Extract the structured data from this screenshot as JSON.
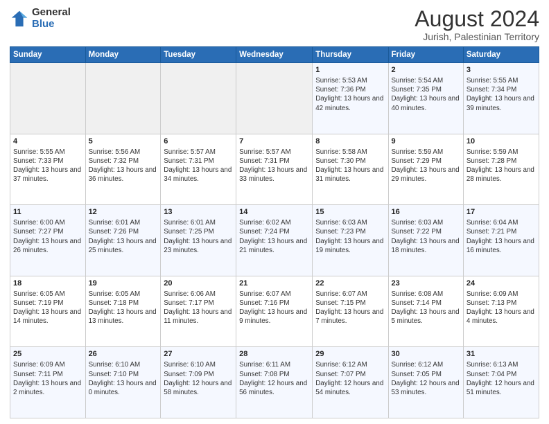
{
  "logo": {
    "general": "General",
    "blue": "Blue"
  },
  "header": {
    "title": "August 2024",
    "subtitle": "Jurish, Palestinian Territory"
  },
  "weekdays": [
    "Sunday",
    "Monday",
    "Tuesday",
    "Wednesday",
    "Thursday",
    "Friday",
    "Saturday"
  ],
  "weeks": [
    [
      {
        "day": "",
        "empty": true
      },
      {
        "day": "",
        "empty": true
      },
      {
        "day": "",
        "empty": true
      },
      {
        "day": "",
        "empty": true
      },
      {
        "day": "1",
        "sunrise": "5:53 AM",
        "sunset": "7:36 PM",
        "daylight": "13 hours and 42 minutes."
      },
      {
        "day": "2",
        "sunrise": "5:54 AM",
        "sunset": "7:35 PM",
        "daylight": "13 hours and 40 minutes."
      },
      {
        "day": "3",
        "sunrise": "5:55 AM",
        "sunset": "7:34 PM",
        "daylight": "13 hours and 39 minutes."
      }
    ],
    [
      {
        "day": "4",
        "sunrise": "5:55 AM",
        "sunset": "7:33 PM",
        "daylight": "13 hours and 37 minutes."
      },
      {
        "day": "5",
        "sunrise": "5:56 AM",
        "sunset": "7:32 PM",
        "daylight": "13 hours and 36 minutes."
      },
      {
        "day": "6",
        "sunrise": "5:57 AM",
        "sunset": "7:31 PM",
        "daylight": "13 hours and 34 minutes."
      },
      {
        "day": "7",
        "sunrise": "5:57 AM",
        "sunset": "7:31 PM",
        "daylight": "13 hours and 33 minutes."
      },
      {
        "day": "8",
        "sunrise": "5:58 AM",
        "sunset": "7:30 PM",
        "daylight": "13 hours and 31 minutes."
      },
      {
        "day": "9",
        "sunrise": "5:59 AM",
        "sunset": "7:29 PM",
        "daylight": "13 hours and 29 minutes."
      },
      {
        "day": "10",
        "sunrise": "5:59 AM",
        "sunset": "7:28 PM",
        "daylight": "13 hours and 28 minutes."
      }
    ],
    [
      {
        "day": "11",
        "sunrise": "6:00 AM",
        "sunset": "7:27 PM",
        "daylight": "13 hours and 26 minutes."
      },
      {
        "day": "12",
        "sunrise": "6:01 AM",
        "sunset": "7:26 PM",
        "daylight": "13 hours and 25 minutes."
      },
      {
        "day": "13",
        "sunrise": "6:01 AM",
        "sunset": "7:25 PM",
        "daylight": "13 hours and 23 minutes."
      },
      {
        "day": "14",
        "sunrise": "6:02 AM",
        "sunset": "7:24 PM",
        "daylight": "13 hours and 21 minutes."
      },
      {
        "day": "15",
        "sunrise": "6:03 AM",
        "sunset": "7:23 PM",
        "daylight": "13 hours and 19 minutes."
      },
      {
        "day": "16",
        "sunrise": "6:03 AM",
        "sunset": "7:22 PM",
        "daylight": "13 hours and 18 minutes."
      },
      {
        "day": "17",
        "sunrise": "6:04 AM",
        "sunset": "7:21 PM",
        "daylight": "13 hours and 16 minutes."
      }
    ],
    [
      {
        "day": "18",
        "sunrise": "6:05 AM",
        "sunset": "7:19 PM",
        "daylight": "13 hours and 14 minutes."
      },
      {
        "day": "19",
        "sunrise": "6:05 AM",
        "sunset": "7:18 PM",
        "daylight": "13 hours and 13 minutes."
      },
      {
        "day": "20",
        "sunrise": "6:06 AM",
        "sunset": "7:17 PM",
        "daylight": "13 hours and 11 minutes."
      },
      {
        "day": "21",
        "sunrise": "6:07 AM",
        "sunset": "7:16 PM",
        "daylight": "13 hours and 9 minutes."
      },
      {
        "day": "22",
        "sunrise": "6:07 AM",
        "sunset": "7:15 PM",
        "daylight": "13 hours and 7 minutes."
      },
      {
        "day": "23",
        "sunrise": "6:08 AM",
        "sunset": "7:14 PM",
        "daylight": "13 hours and 5 minutes."
      },
      {
        "day": "24",
        "sunrise": "6:09 AM",
        "sunset": "7:13 PM",
        "daylight": "13 hours and 4 minutes."
      }
    ],
    [
      {
        "day": "25",
        "sunrise": "6:09 AM",
        "sunset": "7:11 PM",
        "daylight": "13 hours and 2 minutes."
      },
      {
        "day": "26",
        "sunrise": "6:10 AM",
        "sunset": "7:10 PM",
        "daylight": "13 hours and 0 minutes."
      },
      {
        "day": "27",
        "sunrise": "6:10 AM",
        "sunset": "7:09 PM",
        "daylight": "12 hours and 58 minutes."
      },
      {
        "day": "28",
        "sunrise": "6:11 AM",
        "sunset": "7:08 PM",
        "daylight": "12 hours and 56 minutes."
      },
      {
        "day": "29",
        "sunrise": "6:12 AM",
        "sunset": "7:07 PM",
        "daylight": "12 hours and 54 minutes."
      },
      {
        "day": "30",
        "sunrise": "6:12 AM",
        "sunset": "7:05 PM",
        "daylight": "12 hours and 53 minutes."
      },
      {
        "day": "31",
        "sunrise": "6:13 AM",
        "sunset": "7:04 PM",
        "daylight": "12 hours and 51 minutes."
      }
    ]
  ]
}
